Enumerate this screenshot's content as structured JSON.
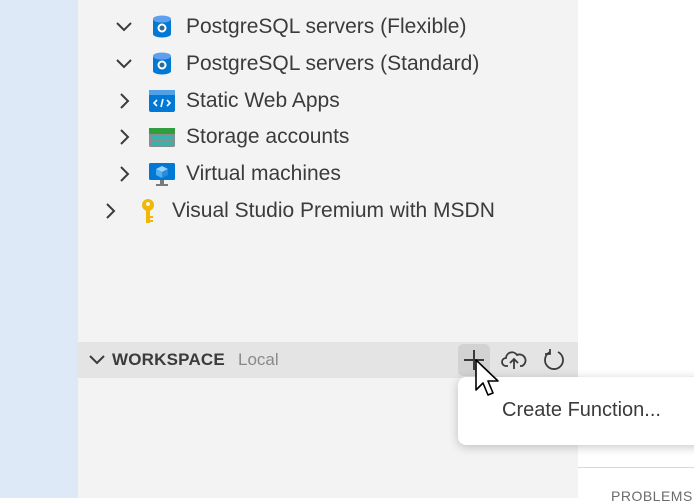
{
  "tree": {
    "items": [
      {
        "label": "PostgreSQL servers (Flexible)",
        "expanded": true,
        "icon": "postgresql-icon"
      },
      {
        "label": "PostgreSQL servers (Standard)",
        "expanded": true,
        "icon": "postgresql-icon"
      },
      {
        "label": "Static Web Apps",
        "expanded": false,
        "icon": "static-web-apps-icon"
      },
      {
        "label": "Storage accounts",
        "expanded": false,
        "icon": "storage-accounts-icon"
      },
      {
        "label": "Virtual machines",
        "expanded": false,
        "icon": "virtual-machine-icon"
      }
    ],
    "subscription": {
      "label": "Visual Studio Premium with MSDN",
      "expanded": false,
      "icon": "key-icon"
    }
  },
  "workspace": {
    "title": "WORKSPACE",
    "subtitle": "Local",
    "actions": [
      "add-icon",
      "cloud-upload-icon",
      "refresh-icon"
    ]
  },
  "context_menu": {
    "items": [
      "Create Function..."
    ]
  },
  "panel": {
    "tab_label": "PROBLEMS"
  },
  "colors": {
    "activity_strip": "#dde9f7",
    "sidebar": "#f3f3f3",
    "section_header": "#e4e4e4",
    "azure_blue": "#0078d4"
  }
}
